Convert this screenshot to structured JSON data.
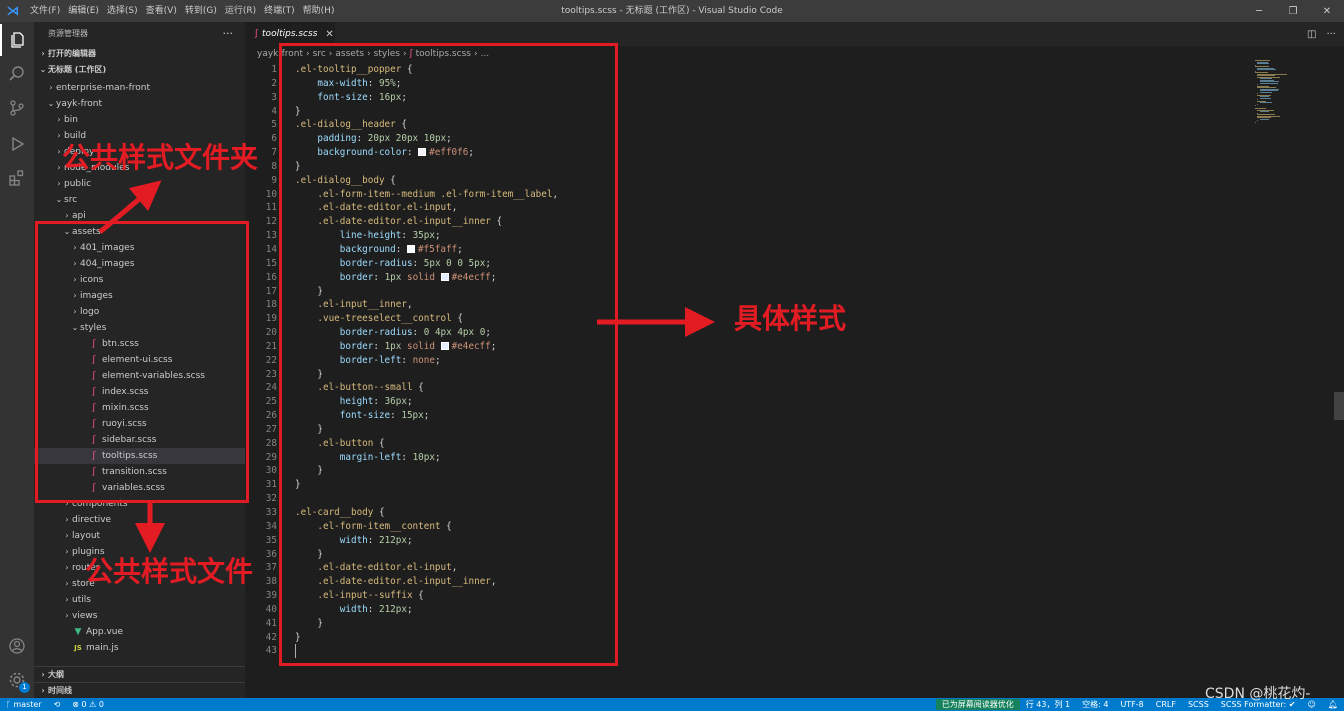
{
  "app": {
    "menu": [
      "文件(F)",
      "编辑(E)",
      "选择(S)",
      "查看(V)",
      "转到(G)",
      "运行(R)",
      "终端(T)",
      "帮助(H)"
    ],
    "window_title": "tooltips.scss - 无标题 (工作区) - Visual Studio Code"
  },
  "sidebar": {
    "title": "资源管理器",
    "more": "···",
    "open_editors": "打开的编辑器",
    "workspace": "无标题 (工作区)",
    "tree": [
      {
        "label": "enterprise-man-front",
        "indent": 1,
        "chev": "›",
        "kind": "folder"
      },
      {
        "label": "yayk-front",
        "indent": 1,
        "chev": "⌄",
        "kind": "folder"
      },
      {
        "label": "bin",
        "indent": 2,
        "chev": "›",
        "kind": "folder"
      },
      {
        "label": "build",
        "indent": 2,
        "chev": "›",
        "kind": "folder"
      },
      {
        "label": "deploy",
        "indent": 2,
        "chev": "›",
        "kind": "folder"
      },
      {
        "label": "node_modules",
        "indent": 2,
        "chev": "›",
        "kind": "folder"
      },
      {
        "label": "public",
        "indent": 2,
        "chev": "›",
        "kind": "folder"
      },
      {
        "label": "src",
        "indent": 2,
        "chev": "⌄",
        "kind": "folder"
      },
      {
        "label": "api",
        "indent": 3,
        "chev": "›",
        "kind": "folder"
      },
      {
        "label": "assets",
        "indent": 3,
        "chev": "⌄",
        "kind": "folder"
      },
      {
        "label": "401_images",
        "indent": 4,
        "chev": "›",
        "kind": "folder"
      },
      {
        "label": "404_images",
        "indent": 4,
        "chev": "›",
        "kind": "folder"
      },
      {
        "label": "icons",
        "indent": 4,
        "chev": "›",
        "kind": "folder"
      },
      {
        "label": "images",
        "indent": 4,
        "chev": "›",
        "kind": "folder"
      },
      {
        "label": "logo",
        "indent": 4,
        "chev": "›",
        "kind": "folder"
      },
      {
        "label": "styles",
        "indent": 4,
        "chev": "⌄",
        "kind": "folder"
      },
      {
        "label": "btn.scss",
        "indent": 5,
        "chev": "",
        "kind": "scss"
      },
      {
        "label": "element-ui.scss",
        "indent": 5,
        "chev": "",
        "kind": "scss"
      },
      {
        "label": "element-variables.scss",
        "indent": 5,
        "chev": "",
        "kind": "scss"
      },
      {
        "label": "index.scss",
        "indent": 5,
        "chev": "",
        "kind": "scss"
      },
      {
        "label": "mixin.scss",
        "indent": 5,
        "chev": "",
        "kind": "scss"
      },
      {
        "label": "ruoyi.scss",
        "indent": 5,
        "chev": "",
        "kind": "scss"
      },
      {
        "label": "sidebar.scss",
        "indent": 5,
        "chev": "",
        "kind": "scss"
      },
      {
        "label": "tooltips.scss",
        "indent": 5,
        "chev": "",
        "kind": "scss",
        "selected": true
      },
      {
        "label": "transition.scss",
        "indent": 5,
        "chev": "",
        "kind": "scss"
      },
      {
        "label": "variables.scss",
        "indent": 5,
        "chev": "",
        "kind": "scss"
      },
      {
        "label": "components",
        "indent": 3,
        "chev": "›",
        "kind": "folder"
      },
      {
        "label": "directive",
        "indent": 3,
        "chev": "›",
        "kind": "folder"
      },
      {
        "label": "layout",
        "indent": 3,
        "chev": "›",
        "kind": "folder"
      },
      {
        "label": "plugins",
        "indent": 3,
        "chev": "›",
        "kind": "folder"
      },
      {
        "label": "router",
        "indent": 3,
        "chev": "›",
        "kind": "folder"
      },
      {
        "label": "store",
        "indent": 3,
        "chev": "›",
        "kind": "folder"
      },
      {
        "label": "utils",
        "indent": 3,
        "chev": "›",
        "kind": "folder"
      },
      {
        "label": "views",
        "indent": 3,
        "chev": "›",
        "kind": "folder"
      },
      {
        "label": "App.vue",
        "indent": 3,
        "chev": "",
        "kind": "vue"
      },
      {
        "label": "main.js",
        "indent": 3,
        "chev": "",
        "kind": "js"
      }
    ],
    "outline": "大纲",
    "timeline": "时间线"
  },
  "editor": {
    "tab_label": "tooltips.scss",
    "breadcrumb": [
      "yayk-front",
      "src",
      "assets",
      "styles",
      "tooltips.scss",
      "..."
    ],
    "cursor_line": 43,
    "code": [
      [
        {
          "t": "sel",
          "v": ".el-tooltip__popper"
        },
        {
          "t": "punc",
          "v": " {"
        }
      ],
      [
        {
          "t": "prop",
          "v": "    max-width"
        },
        {
          "t": "punc",
          "v": ": "
        },
        {
          "t": "num",
          "v": "95%"
        },
        {
          "t": "punc",
          "v": ";"
        }
      ],
      [
        {
          "t": "prop",
          "v": "    font-size"
        },
        {
          "t": "punc",
          "v": ": "
        },
        {
          "t": "num",
          "v": "16px"
        },
        {
          "t": "punc",
          "v": ";"
        }
      ],
      [
        {
          "t": "punc",
          "v": "}"
        }
      ],
      [
        {
          "t": "sel",
          "v": ".el-dialog__header"
        },
        {
          "t": "punc",
          "v": " {"
        }
      ],
      [
        {
          "t": "prop",
          "v": "    padding"
        },
        {
          "t": "punc",
          "v": ": "
        },
        {
          "t": "num",
          "v": "20px 20px 10px"
        },
        {
          "t": "punc",
          "v": ";"
        }
      ],
      [
        {
          "t": "prop",
          "v": "    background-color"
        },
        {
          "t": "punc",
          "v": ": "
        },
        {
          "t": "sw",
          "v": "#eff0f6"
        },
        {
          "t": "val",
          "v": "#eff0f6"
        },
        {
          "t": "punc",
          "v": ";"
        }
      ],
      [
        {
          "t": "punc",
          "v": "}"
        }
      ],
      [
        {
          "t": "sel",
          "v": ".el-dialog__body"
        },
        {
          "t": "punc",
          "v": " {"
        }
      ],
      [
        {
          "t": "sel",
          "v": "    .el-form-item--medium .el-form-item__label"
        },
        {
          "t": "punc",
          "v": ","
        }
      ],
      [
        {
          "t": "sel",
          "v": "    .el-date-editor.el-input"
        },
        {
          "t": "punc",
          "v": ","
        }
      ],
      [
        {
          "t": "sel",
          "v": "    .el-date-editor.el-input__inner"
        },
        {
          "t": "punc",
          "v": " {"
        }
      ],
      [
        {
          "t": "prop",
          "v": "        line-height"
        },
        {
          "t": "punc",
          "v": ": "
        },
        {
          "t": "num",
          "v": "35px"
        },
        {
          "t": "punc",
          "v": ";"
        }
      ],
      [
        {
          "t": "prop",
          "v": "        background"
        },
        {
          "t": "punc",
          "v": ": "
        },
        {
          "t": "sw",
          "v": "#f5faff"
        },
        {
          "t": "val",
          "v": "#f5faff"
        },
        {
          "t": "punc",
          "v": ";"
        }
      ],
      [
        {
          "t": "prop",
          "v": "        border-radius"
        },
        {
          "t": "punc",
          "v": ": "
        },
        {
          "t": "num",
          "v": "5px 0 0 5px"
        },
        {
          "t": "punc",
          "v": ";"
        }
      ],
      [
        {
          "t": "prop",
          "v": "        border"
        },
        {
          "t": "punc",
          "v": ": "
        },
        {
          "t": "num",
          "v": "1px"
        },
        {
          "t": "val",
          "v": " solid "
        },
        {
          "t": "sw",
          "v": "#e4ecff"
        },
        {
          "t": "val",
          "v": "#e4ecff"
        },
        {
          "t": "punc",
          "v": ";"
        }
      ],
      [
        {
          "t": "punc",
          "v": "    }"
        }
      ],
      [
        {
          "t": "sel",
          "v": "    .el-input__inner"
        },
        {
          "t": "punc",
          "v": ","
        }
      ],
      [
        {
          "t": "sel",
          "v": "    .vue-treeselect__control"
        },
        {
          "t": "punc",
          "v": " {"
        }
      ],
      [
        {
          "t": "prop",
          "v": "        border-radius"
        },
        {
          "t": "punc",
          "v": ": "
        },
        {
          "t": "num",
          "v": "0 4px 4px 0"
        },
        {
          "t": "punc",
          "v": ";"
        }
      ],
      [
        {
          "t": "prop",
          "v": "        border"
        },
        {
          "t": "punc",
          "v": ": "
        },
        {
          "t": "num",
          "v": "1px"
        },
        {
          "t": "val",
          "v": " solid "
        },
        {
          "t": "sw",
          "v": "#e4ecff"
        },
        {
          "t": "val",
          "v": "#e4ecff"
        },
        {
          "t": "punc",
          "v": ";"
        }
      ],
      [
        {
          "t": "prop",
          "v": "        border-left"
        },
        {
          "t": "punc",
          "v": ": "
        },
        {
          "t": "val",
          "v": "none"
        },
        {
          "t": "punc",
          "v": ";"
        }
      ],
      [
        {
          "t": "punc",
          "v": "    }"
        }
      ],
      [
        {
          "t": "sel",
          "v": "    .el-button--small"
        },
        {
          "t": "punc",
          "v": " {"
        }
      ],
      [
        {
          "t": "prop",
          "v": "        height"
        },
        {
          "t": "punc",
          "v": ": "
        },
        {
          "t": "num",
          "v": "36px"
        },
        {
          "t": "punc",
          "v": ";"
        }
      ],
      [
        {
          "t": "prop",
          "v": "        font-size"
        },
        {
          "t": "punc",
          "v": ": "
        },
        {
          "t": "num",
          "v": "15px"
        },
        {
          "t": "punc",
          "v": ";"
        }
      ],
      [
        {
          "t": "punc",
          "v": "    }"
        }
      ],
      [
        {
          "t": "sel",
          "v": "    .el-button"
        },
        {
          "t": "punc",
          "v": " {"
        }
      ],
      [
        {
          "t": "prop",
          "v": "        margin-left"
        },
        {
          "t": "punc",
          "v": ": "
        },
        {
          "t": "num",
          "v": "10px"
        },
        {
          "t": "punc",
          "v": ";"
        }
      ],
      [
        {
          "t": "punc",
          "v": "    }"
        }
      ],
      [
        {
          "t": "punc",
          "v": "}"
        }
      ],
      [],
      [
        {
          "t": "sel",
          "v": ".el-card__body"
        },
        {
          "t": "punc",
          "v": " {"
        }
      ],
      [
        {
          "t": "sel",
          "v": "    .el-form-item__content"
        },
        {
          "t": "punc",
          "v": " {"
        }
      ],
      [
        {
          "t": "prop",
          "v": "        width"
        },
        {
          "t": "punc",
          "v": ": "
        },
        {
          "t": "num",
          "v": "212px"
        },
        {
          "t": "punc",
          "v": ";"
        }
      ],
      [
        {
          "t": "punc",
          "v": "    }"
        }
      ],
      [
        {
          "t": "sel",
          "v": "    .el-date-editor.el-input"
        },
        {
          "t": "punc",
          "v": ","
        }
      ],
      [
        {
          "t": "sel",
          "v": "    .el-date-editor.el-input__inner"
        },
        {
          "t": "punc",
          "v": ","
        }
      ],
      [
        {
          "t": "sel",
          "v": "    .el-input--suffix"
        },
        {
          "t": "punc",
          "v": " {"
        }
      ],
      [
        {
          "t": "prop",
          "v": "        width"
        },
        {
          "t": "punc",
          "v": ": "
        },
        {
          "t": "num",
          "v": "212px"
        },
        {
          "t": "punc",
          "v": ";"
        }
      ],
      [
        {
          "t": "punc",
          "v": "    }"
        }
      ],
      [
        {
          "t": "punc",
          "v": "}"
        }
      ],
      []
    ]
  },
  "status": {
    "branch": "master",
    "errors": "0",
    "warnings": "0",
    "screen_reader": "已为屏幕阅读器优化",
    "position": "行 43，列 1",
    "spaces": "空格: 4",
    "encoding": "UTF-8",
    "eol": "CRLF",
    "language": "SCSS",
    "formatter": "SCSS Formatter: ✔"
  },
  "annotations": {
    "folder_label": "公共样式文件夹",
    "file_label": "公共样式文件",
    "detail_label": "具体样式"
  },
  "watermark": "CSDN @桃花灼-",
  "colors": {
    "annotation": "#e31c23",
    "statusbar": "#007acc",
    "selector": "#d7ba7d",
    "property": "#9cdcfe",
    "number": "#b5cea8"
  }
}
